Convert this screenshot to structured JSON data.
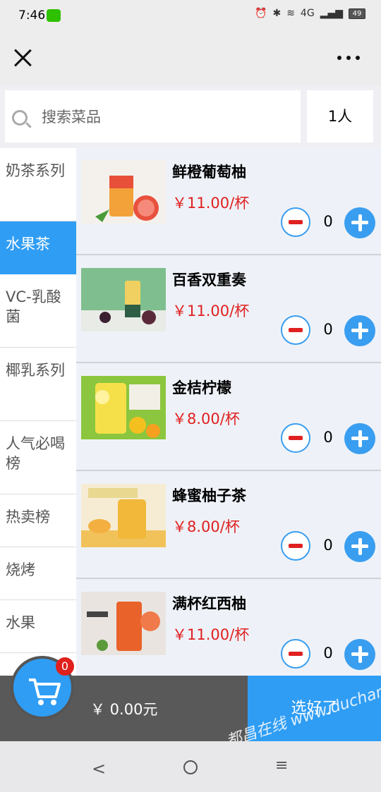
{
  "status_bar": {
    "time": "7:46",
    "network": "4G",
    "battery": "49"
  },
  "header": {
    "close_icon": "close-icon",
    "more_icon": "more-icon"
  },
  "search": {
    "placeholder": "搜索菜品",
    "value": "",
    "people": "1人"
  },
  "categories": [
    {
      "label": "奶茶系列",
      "active": false
    },
    {
      "label": "水果茶",
      "active": true
    },
    {
      "label": "VC-乳酸菌",
      "active": false
    },
    {
      "label": "椰乳系列",
      "active": false
    },
    {
      "label": "人气必喝榜",
      "active": false
    },
    {
      "label": "热卖榜",
      "active": false
    },
    {
      "label": "烧烤",
      "active": false
    },
    {
      "label": "水果",
      "active": false
    }
  ],
  "products": [
    {
      "name": "鲜橙葡萄柚",
      "price": "￥11.00/杯",
      "qty": "0"
    },
    {
      "name": "百香双重奏",
      "price": "￥11.00/杯",
      "qty": "0"
    },
    {
      "name": "金桔柠檬",
      "price": "￥8.00/杯",
      "qty": "0"
    },
    {
      "name": "蜂蜜柚子茶",
      "price": "￥8.00/杯",
      "qty": "0"
    },
    {
      "name": "满杯红西柚",
      "price": "￥11.00/杯",
      "qty": "0"
    }
  ],
  "cart": {
    "badge": "0",
    "total": "￥ 0.00元",
    "checkout": "选好了"
  },
  "watermark": "都昌在线 www.duchang.org",
  "colors": {
    "accent": "#2f9df4",
    "price": "#e02020",
    "cart_bg": "#595959"
  }
}
